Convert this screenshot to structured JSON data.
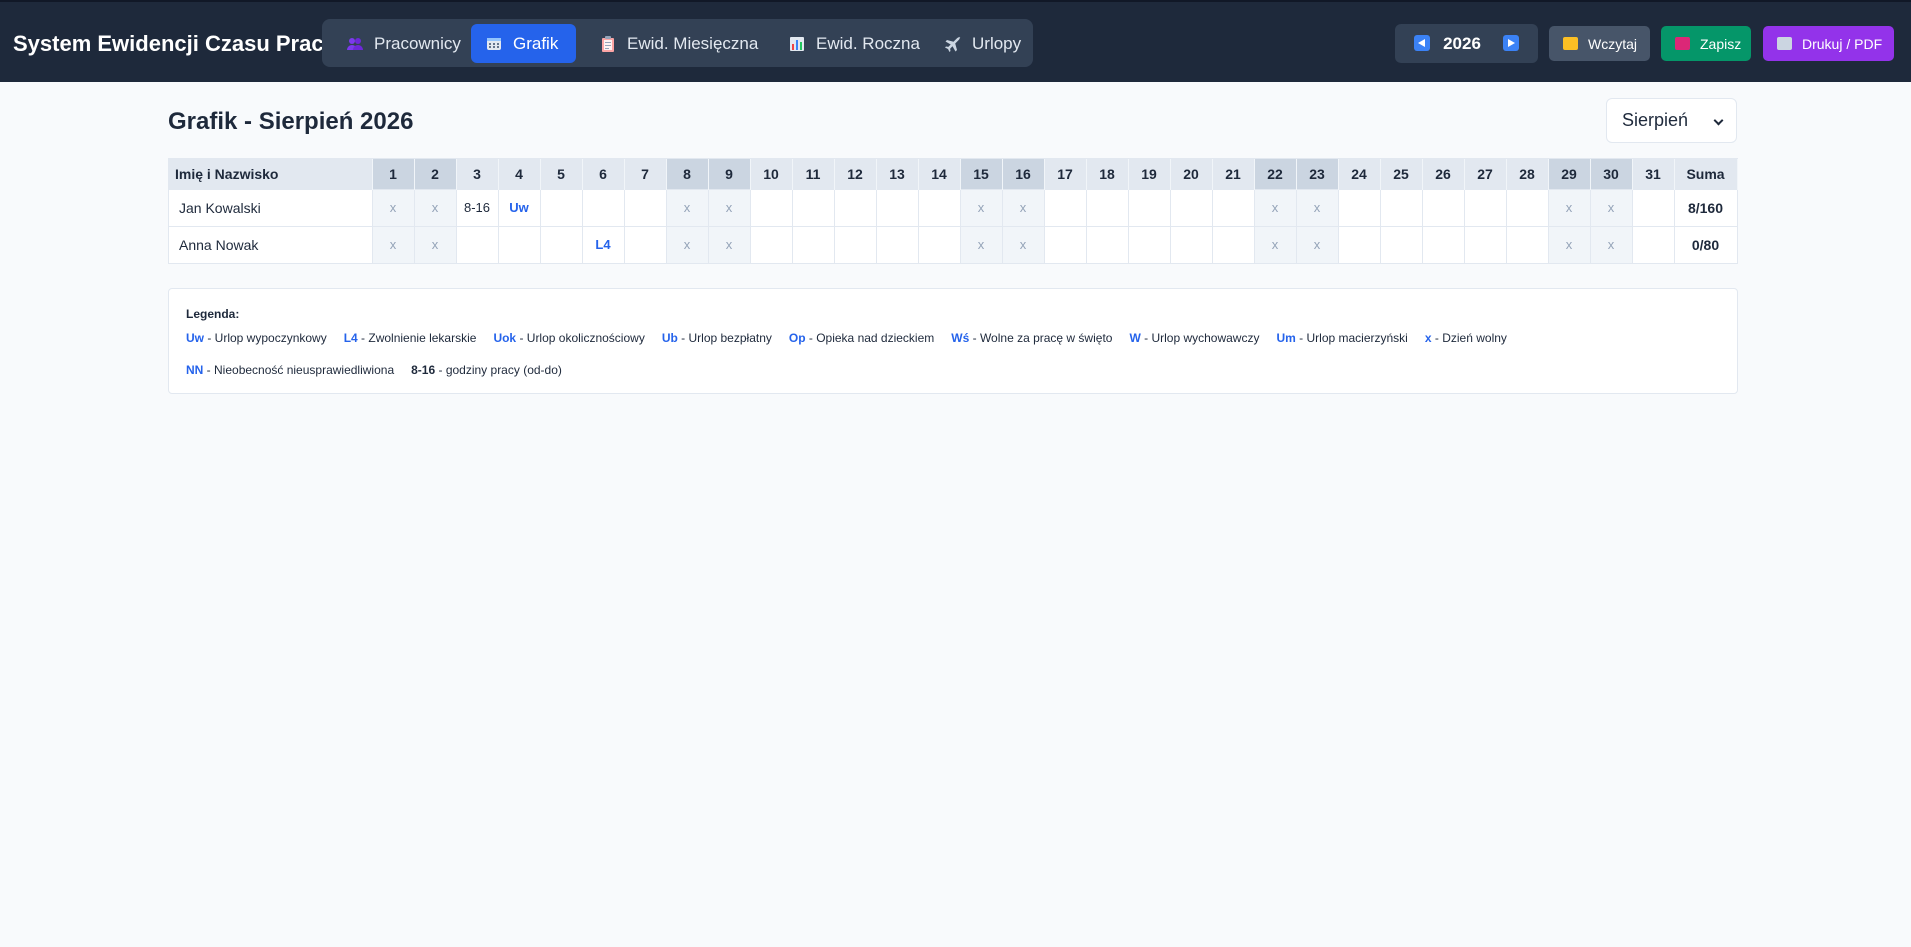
{
  "app": {
    "title": "System Ewidencji Czasu Pracy"
  },
  "nav": {
    "tabs": [
      {
        "label": "Pracownicy",
        "icon": "people-icon",
        "active": false
      },
      {
        "label": "Grafik",
        "icon": "calendar-icon",
        "active": true
      },
      {
        "label": "Ewid. Miesięczna",
        "icon": "clipboard-icon",
        "active": false
      },
      {
        "label": "Ewid. Roczna",
        "icon": "bar-chart-icon",
        "active": false
      },
      {
        "label": "Urlopy",
        "icon": "airplane-icon",
        "active": false
      }
    ]
  },
  "year_selector": {
    "year": "2026",
    "prev_icon": "arrow-left-icon",
    "next_icon": "arrow-right-icon"
  },
  "actions": {
    "load_label": "Wczytaj",
    "save_label": "Zapisz",
    "print_label": "Drukuj / PDF",
    "load_icon": "folder-icon",
    "save_icon": "floppy-disk-icon",
    "print_icon": "printer-icon"
  },
  "page": {
    "title": "Grafik - Sierpień 2026"
  },
  "month_select": {
    "selected": "Sierpień"
  },
  "schedule": {
    "name_header": "Imię i Nazwisko",
    "sum_header": "Suma",
    "days": [
      "1",
      "2",
      "3",
      "4",
      "5",
      "6",
      "7",
      "8",
      "9",
      "10",
      "11",
      "12",
      "13",
      "14",
      "15",
      "16",
      "17",
      "18",
      "19",
      "20",
      "21",
      "22",
      "23",
      "24",
      "25",
      "26",
      "27",
      "28",
      "29",
      "30",
      "31"
    ],
    "weekend_days": [
      1,
      2,
      8,
      9,
      15,
      16,
      22,
      23,
      29,
      30
    ],
    "rows": [
      {
        "name": "Jan Kowalski",
        "cells": [
          "x",
          "x",
          "8-16",
          "Uw",
          "",
          "",
          "",
          "x",
          "x",
          "",
          "",
          "",
          "",
          "",
          "x",
          "x",
          "",
          "",
          "",
          "",
          "",
          "x",
          "x",
          "",
          "",
          "",
          "",
          "",
          "x",
          "x",
          ""
        ],
        "sum": "8/160"
      },
      {
        "name": "Anna Nowak",
        "cells": [
          "x",
          "x",
          "",
          "",
          "",
          "L4",
          "",
          "x",
          "x",
          "",
          "",
          "",
          "",
          "",
          "x",
          "x",
          "",
          "",
          "",
          "",
          "",
          "x",
          "x",
          "",
          "",
          "",
          "",
          "",
          "x",
          "x",
          ""
        ],
        "sum": "0/80"
      }
    ]
  },
  "legend": {
    "title": "Legenda:",
    "row1": [
      {
        "code": "Uw",
        "desc": "Urlop wypoczynkowy"
      },
      {
        "code": "L4",
        "desc": "Zwolnienie lekarskie"
      },
      {
        "code": "Uok",
        "desc": "Urlop okolicznościowy"
      },
      {
        "code": "Ub",
        "desc": "Urlop bezpłatny"
      },
      {
        "code": "Op",
        "desc": "Opieka nad dzieckiem"
      },
      {
        "code": "Wś",
        "desc": "Wolne za pracę w święto"
      },
      {
        "code": "W",
        "desc": "Urlop wychowawczy"
      },
      {
        "code": "Um",
        "desc": "Urlop macierzyński"
      },
      {
        "code": "x",
        "desc": "Dzień wolny"
      }
    ],
    "row2": [
      {
        "code": "NN",
        "desc": "Nieobecność nieusprawiedliwiona"
      },
      {
        "code": "8-16",
        "desc": "godziny pracy (od-do)",
        "dark": true
      }
    ]
  },
  "colors": {
    "topbar": "#1e293b",
    "nav_active": "#2563eb",
    "load_button": "#475569",
    "save_button": "#059669",
    "print_button": "#9333ea",
    "code_text": "#2563eb",
    "weekend_header": "#cbd5e1",
    "weekend_cell": "#f1f5f9"
  }
}
